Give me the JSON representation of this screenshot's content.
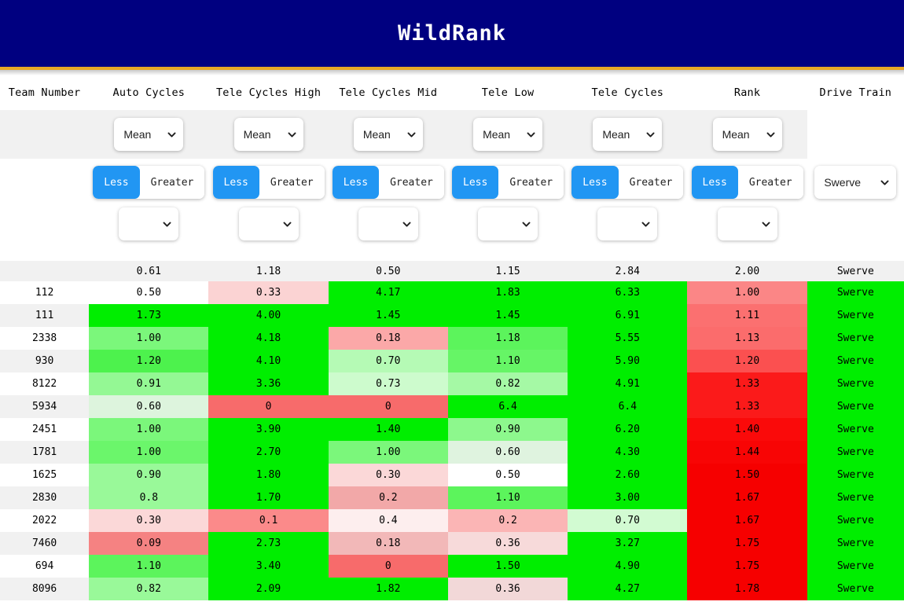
{
  "app": {
    "title": "WildRank",
    "banner_color": "#000080",
    "accent_color": "#e8a825",
    "toggle_active_color": "#2196f3"
  },
  "columns": [
    {
      "key": "team",
      "label": "Team Number",
      "type": "label"
    },
    {
      "key": "auto",
      "label": "Auto Cycles",
      "type": "metric"
    },
    {
      "key": "tele_high",
      "label": "Tele Cycles High",
      "type": "metric"
    },
    {
      "key": "tele_mid",
      "label": "Tele Cycles Mid",
      "type": "metric"
    },
    {
      "key": "tele_low",
      "label": "Tele Low",
      "type": "metric"
    },
    {
      "key": "tele",
      "label": "Tele Cycles",
      "type": "metric"
    },
    {
      "key": "rank",
      "label": "Rank",
      "type": "metric"
    },
    {
      "key": "drive",
      "label": "Drive Train",
      "type": "category"
    }
  ],
  "controls": {
    "stat_selects": [
      {
        "value": "Mean"
      },
      {
        "value": "Mean"
      },
      {
        "value": "Mean"
      },
      {
        "value": "Mean"
      },
      {
        "value": "Mean"
      },
      {
        "value": "Mean"
      }
    ],
    "comparators": [
      {
        "less_label": "Less",
        "greater_label": "Greater",
        "selected": "Less"
      },
      {
        "less_label": "Less",
        "greater_label": "Greater",
        "selected": "Less"
      },
      {
        "less_label": "Less",
        "greater_label": "Greater",
        "selected": "Less"
      },
      {
        "less_label": "Less",
        "greater_label": "Greater",
        "selected": "Less"
      },
      {
        "less_label": "Less",
        "greater_label": "Greater",
        "selected": "Less"
      },
      {
        "less_label": "Less",
        "greater_label": "Greater",
        "selected": "Less"
      }
    ],
    "threshold_selects": [
      {
        "value": ""
      },
      {
        "value": ""
      },
      {
        "value": ""
      },
      {
        "value": ""
      },
      {
        "value": ""
      },
      {
        "value": ""
      }
    ],
    "drive_train_filter": {
      "value": "Swerve"
    }
  },
  "summary_row": {
    "team": "",
    "auto": "0.61",
    "tele_high": "1.18",
    "tele_mid": "0.50",
    "tele_low": "1.15",
    "tele": "2.84",
    "rank": "2.00",
    "drive": "Swerve"
  },
  "rows": [
    {
      "team": "112",
      "auto": "0.50",
      "auto_bg": "#ffffff",
      "tele_high": "0.33",
      "tele_high_bg": "#fbd3d3",
      "tele_mid": "4.17",
      "tele_mid_bg": "#00ee00",
      "tele_low": "1.83",
      "tele_low_bg": "#00ee00",
      "tele": "6.33",
      "tele_bg": "#00ee00",
      "rank": "1.00",
      "rank_bg": "#fb8686",
      "drive": "Swerve",
      "drive_bg": "#00ee00"
    },
    {
      "team": "111",
      "auto": "1.73",
      "auto_bg": "#00ee00",
      "tele_high": "4.00",
      "tele_high_bg": "#00ee00",
      "tele_mid": "1.45",
      "tele_mid_bg": "#00ee00",
      "tele_low": "1.45",
      "tele_low_bg": "#00ee00",
      "tele": "6.91",
      "tele_bg": "#00ee00",
      "rank": "1.11",
      "rank_bg": "#fb7070",
      "drive": "Swerve",
      "drive_bg": "#00ee00"
    },
    {
      "team": "2338",
      "auto": "1.00",
      "auto_bg": "#7bf77b",
      "tele_high": "4.18",
      "tele_high_bg": "#00ee00",
      "tele_mid": "0.18",
      "tele_mid_bg": "#fba8a8",
      "tele_low": "1.18",
      "tele_low_bg": "#5cf45c",
      "tele": "5.55",
      "tele_bg": "#00ee00",
      "rank": "1.13",
      "rank_bg": "#fb6c6c",
      "drive": "Swerve",
      "drive_bg": "#00ee00"
    },
    {
      "team": "930",
      "auto": "1.20",
      "auto_bg": "#4df24d",
      "tele_high": "4.10",
      "tele_high_bg": "#00ee00",
      "tele_mid": "0.70",
      "tele_mid_bg": "#b5fab5",
      "tele_low": "1.10",
      "tele_low_bg": "#66f566",
      "tele": "5.90",
      "tele_bg": "#00ee00",
      "rank": "1.20",
      "rank_bg": "#fb5050",
      "drive": "Swerve",
      "drive_bg": "#00ee00"
    },
    {
      "team": "8122",
      "auto": "0.91",
      "auto_bg": "#94f894",
      "tele_high": "3.36",
      "tele_high_bg": "#00ee00",
      "tele_mid": "0.73",
      "tele_mid_bg": "#cdfbcd",
      "tele_low": "0.82",
      "tele_low_bg": "#a5f9a5",
      "tele": "4.91",
      "tele_bg": "#00ee00",
      "rank": "1.33",
      "rank_bg": "#fb1a1a",
      "drive": "Swerve",
      "drive_bg": "#00ee00"
    },
    {
      "team": "5934",
      "auto": "0.60",
      "auto_bg": "#ddf4dd",
      "tele_high": "0",
      "tele_high_bg": "#f76b6b",
      "tele_mid": "0",
      "tele_mid_bg": "#f76b6b",
      "tele_low": "6.4",
      "tele_low_bg": "#00ee00",
      "tele": "6.4",
      "tele_bg": "#00ee00",
      "rank": "1.33",
      "rank_bg": "#fb1a1a",
      "drive": "Swerve",
      "drive_bg": "#00ee00"
    },
    {
      "team": "2451",
      "auto": "1.00",
      "auto_bg": "#7bf77b",
      "tele_high": "3.90",
      "tele_high_bg": "#00ee00",
      "tele_mid": "1.40",
      "tele_mid_bg": "#00ee00",
      "tele_low": "0.90",
      "tele_low_bg": "#8df88d",
      "tele": "6.20",
      "tele_bg": "#00ee00",
      "rank": "1.40",
      "rank_bg": "#fa0a0a",
      "drive": "Swerve",
      "drive_bg": "#00ee00"
    },
    {
      "team": "1781",
      "auto": "1.00",
      "auto_bg": "#6bf66b",
      "tele_high": "2.70",
      "tele_high_bg": "#00ee00",
      "tele_mid": "1.00",
      "tele_mid_bg": "#7bf77b",
      "tele_low": "0.60",
      "tele_low_bg": "#dff3df",
      "tele": "4.30",
      "tele_bg": "#00ee00",
      "rank": "1.44",
      "rank_bg": "#f80505",
      "drive": "Swerve",
      "drive_bg": "#00ee00"
    },
    {
      "team": "1625",
      "auto": "0.90",
      "auto_bg": "#99f999",
      "tele_high": "1.80",
      "tele_high_bg": "#00ee00",
      "tele_mid": "0.30",
      "tele_mid_bg": "#fbd8d8",
      "tele_low": "0.50",
      "tele_low_bg": "#ffffff",
      "tele": "2.60",
      "tele_bg": "#00ee00",
      "rank": "1.50",
      "rank_bg": "#f60000",
      "drive": "Swerve",
      "drive_bg": "#00ee00"
    },
    {
      "team": "2830",
      "auto": "0.8",
      "auto_bg": "#99f999",
      "tele_high": "1.70",
      "tele_high_bg": "#00ee00",
      "tele_mid": "0.2",
      "tele_mid_bg": "#f2a8a8",
      "tele_low": "1.10",
      "tele_low_bg": "#5cf45c",
      "tele": "3.00",
      "tele_bg": "#00ee00",
      "rank": "1.67",
      "rank_bg": "#f60000",
      "drive": "Swerve",
      "drive_bg": "#00ee00"
    },
    {
      "team": "2022",
      "auto": "0.30",
      "auto_bg": "#fbd8d8",
      "tele_high": "0.1",
      "tele_high_bg": "#fb8a8a",
      "tele_mid": "0.4",
      "tele_mid_bg": "#fdeeee",
      "tele_low": "0.2",
      "tele_low_bg": "#fbb5b5",
      "tele": "0.70",
      "tele_bg": "#d2fbd2",
      "rank": "1.67",
      "rank_bg": "#f60000",
      "drive": "Swerve",
      "drive_bg": "#00ee00"
    },
    {
      "team": "7460",
      "auto": "0.09",
      "auto_bg": "#f58282",
      "tele_high": "2.73",
      "tele_high_bg": "#00ee00",
      "tele_mid": "0.18",
      "tele_mid_bg": "#f2b8b8",
      "tele_low": "0.36",
      "tele_low_bg": "#f7dada",
      "tele": "3.27",
      "tele_bg": "#00ee00",
      "rank": "1.75",
      "rank_bg": "#f60000",
      "drive": "Swerve",
      "drive_bg": "#00ee00"
    },
    {
      "team": "694",
      "auto": "1.10",
      "auto_bg": "#5cf45c",
      "tele_high": "3.40",
      "tele_high_bg": "#00ee00",
      "tele_mid": "0",
      "tele_mid_bg": "#f76b6b",
      "tele_low": "1.50",
      "tele_low_bg": "#00ee00",
      "tele": "4.90",
      "tele_bg": "#00ee00",
      "rank": "1.75",
      "rank_bg": "#f60000",
      "drive": "Swerve",
      "drive_bg": "#00ee00"
    },
    {
      "team": "8096",
      "auto": "0.82",
      "auto_bg": "#99f999",
      "tele_high": "2.09",
      "tele_high_bg": "#00ee00",
      "tele_mid": "1.82",
      "tele_mid_bg": "#00ee00",
      "tele_low": "0.36",
      "tele_low_bg": "#f2d8d8",
      "tele": "4.27",
      "tele_bg": "#00ee00",
      "rank": "1.78",
      "rank_bg": "#f60000",
      "drive": "Swerve",
      "drive_bg": "#00ee00"
    }
  ]
}
